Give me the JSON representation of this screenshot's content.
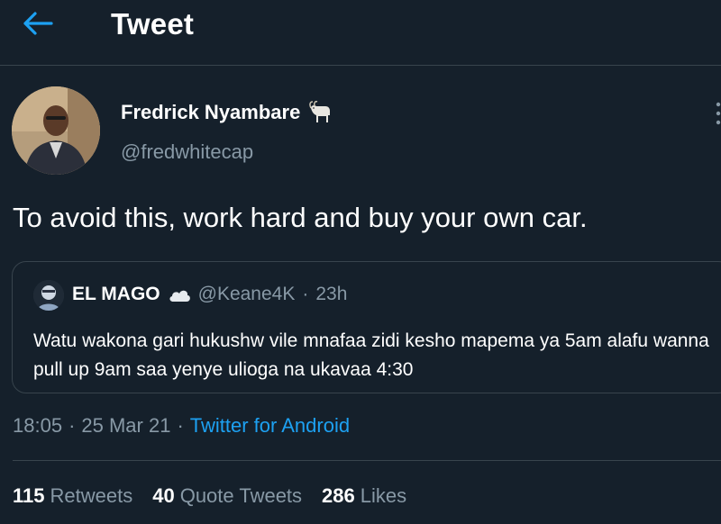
{
  "header": {
    "title": "Tweet",
    "back_icon": "arrow-left-icon",
    "accent": "#1da1f2"
  },
  "author": {
    "name": "Fredrick Nyambare",
    "handle": "@fredwhitecap",
    "badge_icon": "goat-emoji-icon"
  },
  "tweet": {
    "text": "To avoid this, work hard and buy your own car."
  },
  "quote": {
    "name": "EL MAGO",
    "badge_icon": "cloud-emoji-icon",
    "handle": "@Keane4K",
    "dot": "·",
    "time": "23h",
    "text": "Watu wakona gari hukushw vile mnafaa zidi kesho mapema ya 5am alafu wanna pull up 9am saa yenye ulioga na ukavaa 4:30"
  },
  "meta": {
    "time": "18:05",
    "sep1": "·",
    "date": "25 Mar 21",
    "sep2": "·",
    "source": "Twitter for Android"
  },
  "stats": {
    "retweets_count": "115",
    "retweets_label": "Retweets",
    "quotes_count": "40",
    "quotes_label": "Quote Tweets",
    "likes_count": "286",
    "likes_label": "Likes"
  },
  "colors": {
    "background": "#15202b",
    "border": "#38444d",
    "secondary_text": "#8899a6",
    "link": "#1da1f2"
  }
}
